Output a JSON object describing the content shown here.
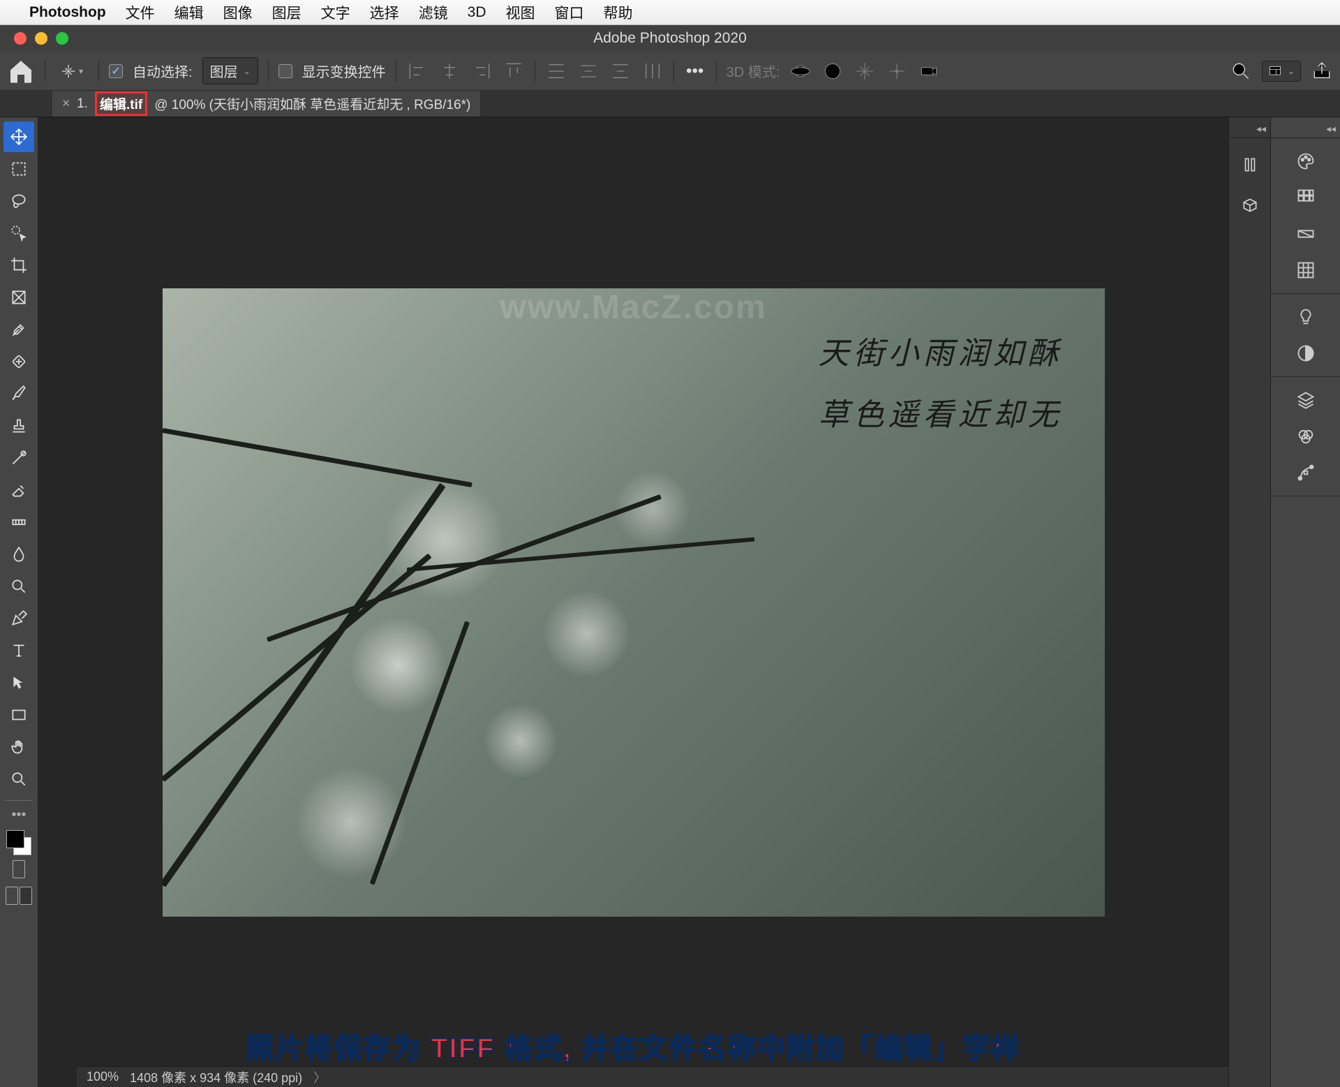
{
  "mac_menu": {
    "app": "Photoshop",
    "items": [
      "文件",
      "编辑",
      "图像",
      "图层",
      "文字",
      "选择",
      "滤镜",
      "3D",
      "视图",
      "窗口",
      "帮助"
    ]
  },
  "window": {
    "title": "Adobe Photoshop 2020"
  },
  "options_bar": {
    "auto_select_label": "自动选择:",
    "auto_select_target": "图层",
    "show_transform": "显示变换控件",
    "mode_3d_label": "3D 模式:"
  },
  "document_tab": {
    "prefix": "1.",
    "highlight": "编辑.tif",
    "suffix": "@ 100% (天街小雨润如酥 草色遥看近却无  , RGB/16*)"
  },
  "canvas_art": {
    "watermark": "www.MacZ.com",
    "poem_line1": "天街小雨润如酥",
    "poem_line2": "草色遥看近却无"
  },
  "caption": "照片将保存为 TIFF 格式,    并在文件名称中附加「编辑」字样",
  "status_bar": {
    "zoom": "100%",
    "dimensions": "1408 像素 x 934 像素 (240 ppi)"
  }
}
